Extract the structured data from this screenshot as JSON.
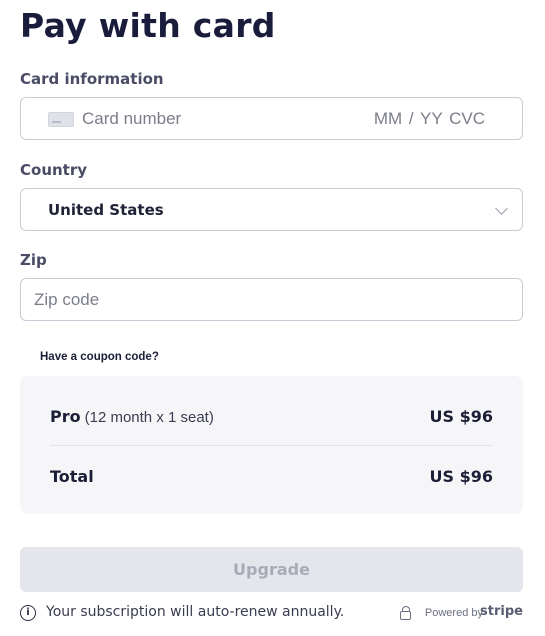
{
  "header": {
    "title": "Pay with card"
  },
  "card_info": {
    "label": "Card information",
    "number_placeholder": "Card number",
    "expiry_cvc_placeholder": "MM / YY  CVC"
  },
  "country": {
    "label": "Country",
    "selected": "United States"
  },
  "zip": {
    "label": "Zip",
    "placeholder": "Zip code"
  },
  "coupon": {
    "link_label": "Have a coupon code?"
  },
  "summary": {
    "items": [
      {
        "name": "Pro",
        "detail": "(12 month x 1 seat)",
        "price": "US $96"
      }
    ],
    "total_label": "Total",
    "total_price": "US $96"
  },
  "actions": {
    "upgrade_label": "Upgrade"
  },
  "footer": {
    "info_icon": "info-icon",
    "renew_text": "Your subscription will auto-renew annually.",
    "lock_icon": "lock-icon",
    "powered_by": "Powered by",
    "brand": "stripe"
  }
}
